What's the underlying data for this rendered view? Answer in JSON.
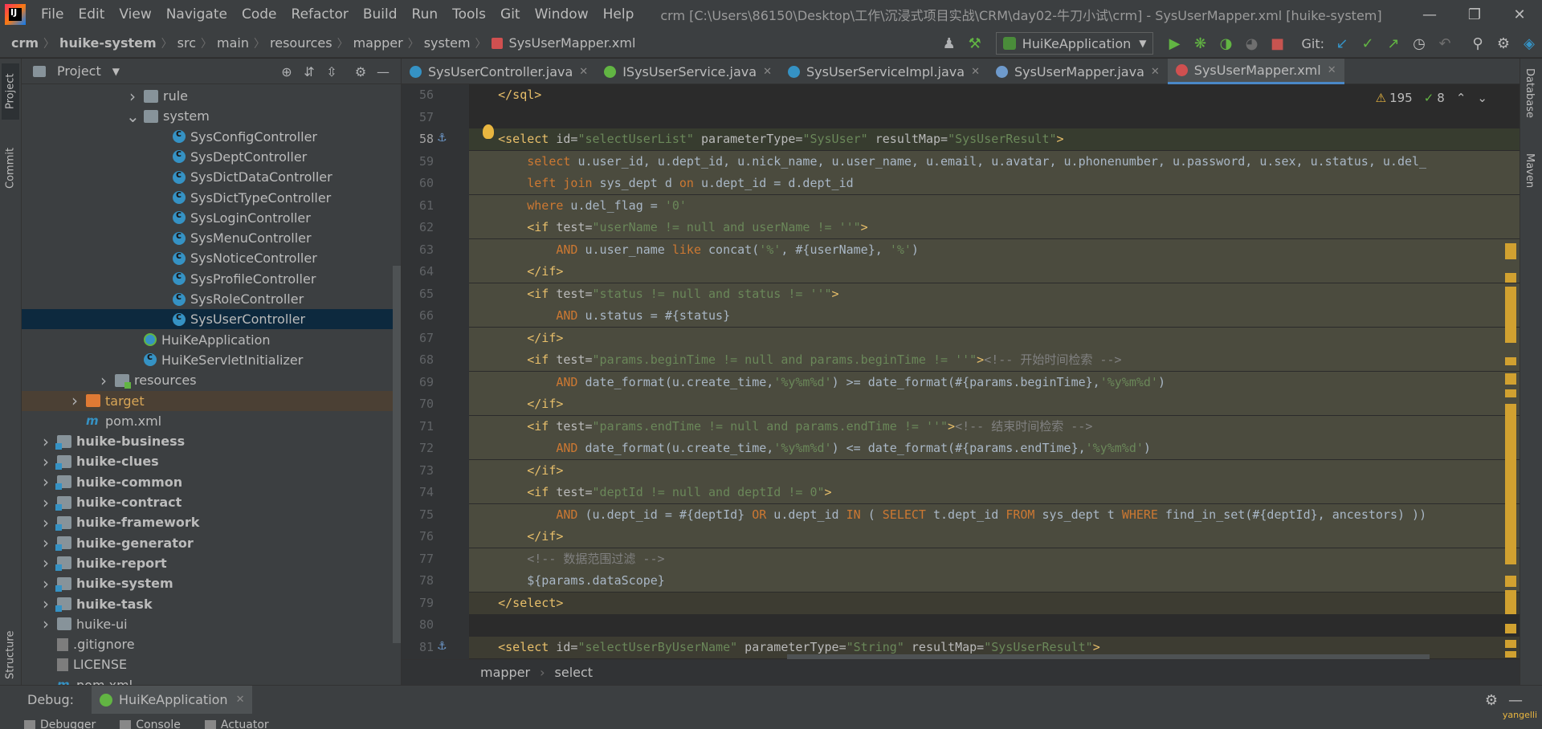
{
  "titlebar": {
    "logo_text": "IJ",
    "menu": [
      "File",
      "Edit",
      "View",
      "Navigate",
      "Code",
      "Refactor",
      "Build",
      "Run",
      "Tools",
      "Git",
      "Window",
      "Help"
    ],
    "title": "crm [C:\\Users\\86150\\Desktop\\工作\\沉浸式项目实战\\CRM\\day02-牛刀小试\\crm] - SysUserMapper.xml [huike-system]"
  },
  "navbar": {
    "crumbs": [
      "crm",
      "huike-system",
      "src",
      "main",
      "resources",
      "mapper",
      "system",
      "SysUserMapper.xml"
    ],
    "run_config": "HuiKeApplication",
    "git_label": "Git:"
  },
  "left_strip": {
    "project": "Project",
    "commit": "Commit",
    "structure": "Structure"
  },
  "project_panel": {
    "title": "Project",
    "tree": [
      {
        "label": "rule",
        "indent": 3,
        "arrow": "right",
        "icon": "folder"
      },
      {
        "label": "system",
        "indent": 3,
        "arrow": "down",
        "icon": "folder"
      },
      {
        "label": "SysConfigController",
        "indent": 4,
        "icon": "class"
      },
      {
        "label": "SysDeptController",
        "indent": 4,
        "icon": "class"
      },
      {
        "label": "SysDictDataController",
        "indent": 4,
        "icon": "class"
      },
      {
        "label": "SysDictTypeController",
        "indent": 4,
        "icon": "class"
      },
      {
        "label": "SysLoginController",
        "indent": 4,
        "icon": "class"
      },
      {
        "label": "SysMenuController",
        "indent": 4,
        "icon": "class"
      },
      {
        "label": "SysNoticeController",
        "indent": 4,
        "icon": "class"
      },
      {
        "label": "SysProfileController",
        "indent": 4,
        "icon": "class"
      },
      {
        "label": "SysRoleController",
        "indent": 4,
        "icon": "class"
      },
      {
        "label": "SysUserController",
        "indent": 4,
        "icon": "class",
        "selected": true
      },
      {
        "label": "HuiKeApplication",
        "indent": 3,
        "icon": "spring"
      },
      {
        "label": "HuiKeServletInitializer",
        "indent": 3,
        "icon": "class"
      },
      {
        "label": "resources",
        "indent": 2,
        "arrow": "right",
        "icon": "folder-src"
      },
      {
        "label": "target",
        "indent": 1,
        "arrow": "right",
        "icon": "folder-target",
        "target": true
      },
      {
        "label": "pom.xml",
        "indent": 1,
        "icon": "maven"
      },
      {
        "label": "huike-business",
        "indent": 0,
        "arrow": "right",
        "icon": "module",
        "bold": true
      },
      {
        "label": "huike-clues",
        "indent": 0,
        "arrow": "right",
        "icon": "module",
        "bold": true
      },
      {
        "label": "huike-common",
        "indent": 0,
        "arrow": "right",
        "icon": "module",
        "bold": true
      },
      {
        "label": "huike-contract",
        "indent": 0,
        "arrow": "right",
        "icon": "module",
        "bold": true
      },
      {
        "label": "huike-framework",
        "indent": 0,
        "arrow": "right",
        "icon": "module",
        "bold": true
      },
      {
        "label": "huike-generator",
        "indent": 0,
        "arrow": "right",
        "icon": "module",
        "bold": true
      },
      {
        "label": "huike-report",
        "indent": 0,
        "arrow": "right",
        "icon": "module",
        "bold": true
      },
      {
        "label": "huike-system",
        "indent": 0,
        "arrow": "right",
        "icon": "module",
        "bold": true
      },
      {
        "label": "huike-task",
        "indent": 0,
        "arrow": "right",
        "icon": "module",
        "bold": true
      },
      {
        "label": "huike-ui",
        "indent": 0,
        "arrow": "right",
        "icon": "folder"
      },
      {
        "label": ".gitignore",
        "indent": 0,
        "icon": "file"
      },
      {
        "label": "LICENSE",
        "indent": 0,
        "icon": "file"
      },
      {
        "label": "pom.xml",
        "indent": 0,
        "icon": "maven"
      }
    ]
  },
  "editor": {
    "tabs": [
      {
        "label": "SysUserController.java",
        "color": "#3592c4"
      },
      {
        "label": "ISysUserService.java",
        "color": "#62b543"
      },
      {
        "label": "SysUserServiceImpl.java",
        "color": "#3592c4"
      },
      {
        "label": "SysUserMapper.java",
        "color": "#6e9acc"
      },
      {
        "label": "SysUserMapper.xml",
        "color": "#d05050",
        "active": true
      }
    ],
    "inspections": {
      "warnings": "195",
      "weak": "8"
    },
    "lines": [
      {
        "n": "56",
        "html": "    <span class=\"tag\">&lt;/sql&gt;</span>",
        "cls": ""
      },
      {
        "n": "57",
        "html": "",
        "cls": ""
      },
      {
        "n": "58",
        "html": "    <span class=\"tag\">&lt;select </span><span class=\"attr\">id=</span><span class=\"str\">\"selectUserList\"</span><span class=\"attr\"> parameterType=</span><span class=\"str\">\"SysUser\"</span><span class=\"attr\"> resultMap=</span><span class=\"str\">\"SysUserResult\"</span><span class=\"tag\">&gt;</span>",
        "cls": "cur"
      },
      {
        "n": "59",
        "html": "        <span class=\"kw\">select</span> u.user_id, u.dept_id, u.nick_name, u.user_name, u.email, u.avatar, u.phonenumber, u.password, u.sex, u.status, u.del_",
        "cls": "sel"
      },
      {
        "n": "60",
        "html": "        <span class=\"kw\">left join</span> sys_dept d <span class=\"kw\">on</span> u.dept_id = d.dept_id",
        "cls": "sel"
      },
      {
        "n": "61",
        "html": "        <span class=\"kw\">where</span> u.del_flag = <span class=\"str\">'0'</span>",
        "cls": "sel"
      },
      {
        "n": "62",
        "html": "        <span class=\"tag\">&lt;if </span><span class=\"attr\">test=</span><span class=\"str\">\"userName != null and userName != ''\"</span><span class=\"tag\">&gt;</span>",
        "cls": "sel"
      },
      {
        "n": "63",
        "html": "            <span class=\"kw\">AND</span> u.user_name <span class=\"kw\">like</span> concat(<span class=\"str\">'%'</span>, #{userName}, <span class=\"str\">'%'</span>)",
        "cls": "sel"
      },
      {
        "n": "64",
        "html": "        <span class=\"tag\">&lt;/if&gt;</span>",
        "cls": "sel"
      },
      {
        "n": "65",
        "html": "        <span class=\"tag\">&lt;if </span><span class=\"attr\">test=</span><span class=\"str\">\"status != null and status != ''\"</span><span class=\"tag\">&gt;</span>",
        "cls": "sel"
      },
      {
        "n": "66",
        "html": "            <span class=\"kw\">AND</span> u.status = #{status}",
        "cls": "sel"
      },
      {
        "n": "67",
        "html": "        <span class=\"tag\">&lt;/if&gt;</span>",
        "cls": "sel"
      },
      {
        "n": "68",
        "html": "        <span class=\"tag\">&lt;if </span><span class=\"attr\">test=</span><span class=\"str\">\"params.beginTime != null and params.beginTime != ''\"</span><span class=\"tag\">&gt;</span><span class=\"cmt\">&lt;!-- 开始时间检索 --&gt;</span>",
        "cls": "sel"
      },
      {
        "n": "69",
        "html": "            <span class=\"kw\">AND</span> date_format(u.create_time,<span class=\"str\">'%y%m%d'</span>) &gt;= date_format(#{params.beginTime},<span class=\"str\">'%y%m%d'</span>)",
        "cls": "sel"
      },
      {
        "n": "70",
        "html": "        <span class=\"tag\">&lt;/if&gt;</span>",
        "cls": "sel"
      },
      {
        "n": "71",
        "html": "        <span class=\"tag\">&lt;if </span><span class=\"attr\">test=</span><span class=\"str\">\"params.endTime != null and params.endTime != ''\"</span><span class=\"tag\">&gt;</span><span class=\"cmt\">&lt;!-- 结束时间检索 --&gt;</span>",
        "cls": "sel"
      },
      {
        "n": "72",
        "html": "            <span class=\"kw\">AND</span> date_format(u.create_time,<span class=\"str\">'%y%m%d'</span>) &lt;= date_format(#{params.endTime},<span class=\"str\">'%y%m%d'</span>)",
        "cls": "sel"
      },
      {
        "n": "73",
        "html": "        <span class=\"tag\">&lt;/if&gt;</span>",
        "cls": "sel"
      },
      {
        "n": "74",
        "html": "        <span class=\"tag\">&lt;if </span><span class=\"attr\">test=</span><span class=\"str\">\"deptId != null and deptId != 0\"</span><span class=\"tag\">&gt;</span>",
        "cls": "sel"
      },
      {
        "n": "75",
        "html": "            <span class=\"kw\">AND</span> (u.dept_id = #{deptId} <span class=\"kw\">OR</span> u.dept_id <span class=\"kw\">IN</span> ( <span class=\"kw\">SELECT</span> t.dept_id <span class=\"kw\">FROM</span> sys_dept t <span class=\"kw\">WHERE</span> find_in_set(#{deptId}, ancestors) ))",
        "cls": "sel"
      },
      {
        "n": "76",
        "html": "        <span class=\"tag\">&lt;/if&gt;</span>",
        "cls": "sel"
      },
      {
        "n": "77",
        "html": "        <span class=\"cmt\">&lt;!-- 数据范围过滤 --&gt;</span>",
        "cls": "sel"
      },
      {
        "n": "78",
        "html": "        ${params.dataScope}",
        "cls": "sel"
      },
      {
        "n": "79",
        "html": "    <span class=\"tag\">&lt;/select&gt;</span>",
        "cls": "sel2"
      },
      {
        "n": "80",
        "html": "",
        "cls": ""
      },
      {
        "n": "81",
        "html": "    <span class=\"tag\">&lt;select </span><span class=\"attr\">id=</span><span class=\"str\">\"selectUserByUserName\"</span><span class=\"attr\"> parameterType=</span><span class=\"str\">\"String\"</span><span class=\"attr\"> resultMap=</span><span class=\"str\">\"SysUserResult\"</span><span class=\"tag\">&gt;</span>",
        "cls": "sel2"
      }
    ],
    "breadcrumb": [
      "mapper",
      "select"
    ]
  },
  "right_strip": {
    "database": "Database",
    "maven": "Maven"
  },
  "debug": {
    "label": "Debug:",
    "tab": "HuiKeApplication",
    "subtabs": [
      "Debugger",
      "Console",
      "Actuator"
    ],
    "user": "yangelli"
  }
}
